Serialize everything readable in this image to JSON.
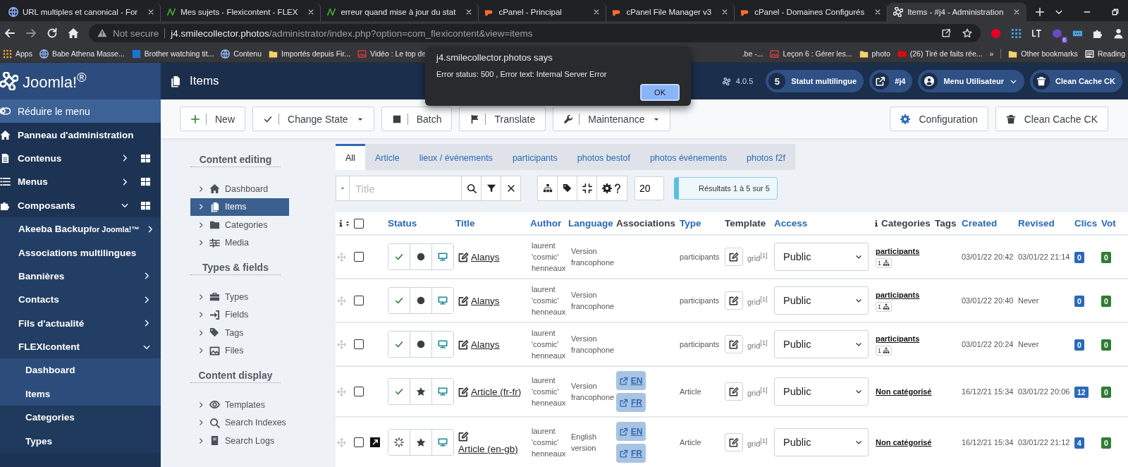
{
  "browser": {
    "tabs": [
      {
        "title": "URL multiples et canonical - For",
        "selected": false
      },
      {
        "title": "Mes sujets - Flexicontent - FLEX",
        "selected": false
      },
      {
        "title": "erreur quand mise à jour du stat",
        "selected": false
      },
      {
        "title": "cPanel - Principal",
        "selected": false
      },
      {
        "title": "cPanel File Manager v3",
        "selected": false
      },
      {
        "title": "cPanel - Domaines Configurés",
        "selected": false
      },
      {
        "title": "Items - #j4 - Administration",
        "selected": true
      }
    ],
    "address": {
      "security": "Not secure",
      "host": "j4.smilecollector.photos",
      "path": "/administrator/index.php?option=com_flexicontent&view=items"
    },
    "extension_badge": "6",
    "bookmarks_left": [
      "Apps",
      "Babe Athena Masse...",
      "Brother watching tit...",
      "Contenu",
      "Importés depuis Fir...",
      "Vidéo : Le top de"
    ],
    "bookmarks_right": [
      ".be -...",
      "Leçon 6 : Gérer les...",
      "photo",
      "(26) Tiré de faits rée..."
    ],
    "overflow": "»",
    "bookmarks_end": [
      "Other bookmarks",
      "Reading"
    ]
  },
  "dialog": {
    "title": "j4.smilecollector.photos says",
    "message": "Error status: 500 , Error text: Internal Server Error",
    "button": "OK"
  },
  "sidebar": {
    "logo": "Joomla!$^{®}$",
    "items": [
      {
        "label": "Réduire le menu",
        "kind": "toggle"
      },
      {
        "label": "Panneau d'administration",
        "kind": "link",
        "dashboard": false
      },
      {
        "label": "Contenus",
        "kind": "link",
        "expanded": false,
        "dashboard": true
      },
      {
        "label": "Menus",
        "kind": "link",
        "expanded": false,
        "dashboard": true
      },
      {
        "label": "Composants",
        "kind": "link",
        "expanded": true,
        "dashboard": true,
        "children": [
          {
            "label": "Akeeba Backup",
            "suffix": "for Joomla!™",
            "expanded": false
          },
          {
            "label": "Associations multilingues"
          },
          {
            "label": "Bannières",
            "expanded": false
          },
          {
            "label": "Contacts",
            "expanded": false
          },
          {
            "label": "Fils d'actualité",
            "expanded": false
          },
          {
            "label": "FLEXIcontent",
            "expanded": true,
            "children": [
              {
                "label": "Dashboard",
                "highlighted": true
              },
              {
                "label": "Items",
                "highlighted": true
              },
              {
                "label": "Categories",
                "highlighted": false
              },
              {
                "label": "Types",
                "highlighted": false
              }
            ]
          }
        ]
      }
    ]
  },
  "header": {
    "title": "Items",
    "version": "4.0.5",
    "pills": [
      {
        "label": "Statut multilingue",
        "count": "5",
        "dropdown": false
      },
      {
        "label": "#j4",
        "dropdown": false
      },
      {
        "label": "Menu Utilisateur",
        "dropdown": true
      },
      {
        "label": "Clean Cache CK",
        "dropdown": false
      }
    ]
  },
  "toolbar": {
    "left": [
      {
        "label": "New",
        "dropdown": false
      },
      {
        "label": "Change State",
        "dropdown": true
      },
      {
        "label": "Batch",
        "dropdown": false
      },
      {
        "label": "Translate",
        "dropdown": false
      },
      {
        "label": "Maintenance",
        "dropdown": true
      }
    ],
    "right": [
      "Configuration",
      "Clean Cache CK"
    ]
  },
  "content_nav": [
    {
      "heading": "Content editing",
      "items": [
        {
          "label": "Dashboard",
          "selected": false
        },
        {
          "label": "Items",
          "selected": true
        },
        {
          "label": "Categories",
          "selected": false
        },
        {
          "label": "Media",
          "selected": false
        }
      ]
    },
    {
      "heading": "Types & fields",
      "items": [
        {
          "label": "Types",
          "selected": false
        },
        {
          "label": "Fields",
          "selected": false
        },
        {
          "label": "Tags",
          "selected": false
        },
        {
          "label": "Files",
          "selected": false
        }
      ]
    },
    {
      "heading": "Content display",
      "items": [
        {
          "label": "Templates",
          "selected": false
        },
        {
          "label": "Search Indexes",
          "selected": false
        },
        {
          "label": "Search Logs",
          "selected": false
        }
      ]
    }
  ],
  "type_tabs": [
    {
      "label": "All",
      "selected": true
    },
    {
      "label": "Article",
      "selected": false
    },
    {
      "label": "lieux / événements",
      "selected": false
    },
    {
      "label": "participants",
      "selected": false
    },
    {
      "label": "photos bestof",
      "selected": false
    },
    {
      "label": "photos événements",
      "selected": false
    },
    {
      "label": "photos f2f",
      "selected": false
    }
  ],
  "filters": {
    "placeholder": "Title",
    "limit": "20",
    "results": "Résultats 1 à 5 sur 5"
  },
  "table": {
    "all_checked": false,
    "columns": [
      {
        "label": "Status",
        "sortable": true,
        "info": false
      },
      {
        "label": "Title",
        "sortable": true,
        "info": false
      },
      {
        "label": "Author",
        "sortable": true,
        "info": false
      },
      {
        "label": "Language",
        "sortable": true,
        "info": false
      },
      {
        "label": "Associations",
        "sortable": false,
        "info": false
      },
      {
        "label": "Type",
        "sortable": true,
        "info": false
      },
      {
        "label": "Template",
        "sortable": false,
        "info": false
      },
      {
        "label": "Access",
        "sortable": true,
        "info": false
      },
      {
        "label": "Categories",
        "sortable": false,
        "info": true
      },
      {
        "label": "Tags",
        "sortable": false,
        "info": false
      },
      {
        "label": "Created",
        "sortable": true,
        "info": false
      },
      {
        "label": "Revised",
        "sortable": true,
        "info": false
      },
      {
        "label": "Clics",
        "sortable": true,
        "info": false
      },
      {
        "label": "Vot",
        "sortable": true,
        "info": false
      }
    ],
    "rows": [
      {
        "checked": false,
        "linked": false,
        "published": true,
        "featured": false,
        "title": "Alanys",
        "author": "laurent 'cosmic' henneaux",
        "language": "Version francophone",
        "type": "participants",
        "template": "grid$^{[1]}$",
        "access": "Public",
        "category": "participants",
        "category_count": "1",
        "created": "03/01/22 20:42",
        "revised": "03/01/22 21:14",
        "clics": "0",
        "votes": "0"
      },
      {
        "checked": false,
        "linked": false,
        "published": true,
        "featured": false,
        "title": "Alanys",
        "author": "laurent 'cosmic' henneaux",
        "language": "Version francophone",
        "type": "participants",
        "template": "grid$^{[1]}$",
        "access": "Public",
        "category": "participants",
        "category_count": "1",
        "created": "03/01/22 20:40",
        "revised": "Never",
        "clics": "0",
        "votes": "0"
      },
      {
        "checked": false,
        "linked": false,
        "published": true,
        "featured": false,
        "title": "Alanys",
        "author": "laurent 'cosmic' henneaux",
        "language": "Version francophone",
        "type": "participants",
        "template": "grid$^{[1]}$",
        "access": "Public",
        "category": "participants",
        "category_count": "1",
        "created": "03/01/22 20:24",
        "revised": "Never",
        "clics": "0",
        "votes": "0"
      },
      {
        "checked": false,
        "linked": false,
        "published": true,
        "featured": true,
        "title": "Article (fr-fr)",
        "author": "laurent 'cosmic' henneaux",
        "language": "Version francophone",
        "associations": [
          "EN",
          "FR"
        ],
        "type": "Article",
        "template": "grid$^{[1]}$",
        "access": "Public",
        "category": "Non catégorisé",
        "created": "16/12/21 15:34",
        "revised": "03/01/22 20:06",
        "clics": "12",
        "votes": "0"
      },
      {
        "checked": false,
        "linked": true,
        "published": false,
        "featured": true,
        "title": "Article (en-gb)",
        "author": "laurent 'cosmic' henneaux",
        "language": "English version",
        "associations": [
          "EN",
          "FR"
        ],
        "type": "Article",
        "template": "grid$^{[1]}$",
        "access": "Public",
        "category": "Non catégorisé",
        "created": "16/12/21 15:34",
        "revised": "03/01/22 21:12",
        "clics": "4",
        "votes": "0"
      }
    ]
  }
}
